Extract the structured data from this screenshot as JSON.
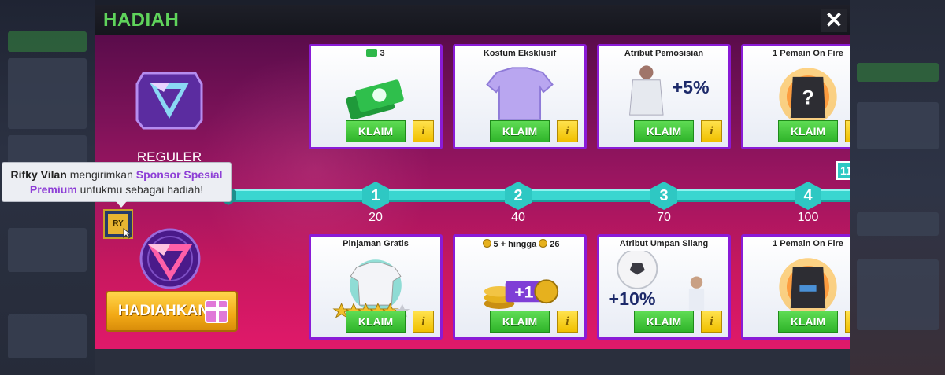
{
  "modal": {
    "title": "HADIAH",
    "close_glyph": "✕"
  },
  "tiers": {
    "regular_label": "REGULER",
    "gift_button_label": "HADIAHKAN"
  },
  "tooltip": {
    "sender": "Rifky Vilan",
    "text_before": " mengirimkan ",
    "highlight": "Sponsor Spesial Premium",
    "text_after": " untukmu sebagai hadiah!"
  },
  "avatar_initials": "RY",
  "edge_badge": "11",
  "milestones": [
    {
      "number": "1",
      "value": "20"
    },
    {
      "number": "2",
      "value": "40"
    },
    {
      "number": "3",
      "value": "70"
    },
    {
      "number": "4",
      "value": "100"
    }
  ],
  "regular_rewards": [
    {
      "title": "3",
      "title_icon": "cash-icon",
      "art": "cash-stack",
      "claim": "KLAIM",
      "info": "i"
    },
    {
      "title": "Kostum Eksklusif",
      "art": "jersey",
      "claim": "KLAIM",
      "info": "i"
    },
    {
      "title": "Atribut Pemosisian",
      "art": "player-plus-5",
      "overlay": "+5%",
      "claim": "KLAIM",
      "info": "i"
    },
    {
      "title": "1 Pemain On Fire",
      "art": "mystery-jersey-fire",
      "claim": "KLAIM",
      "info": "i"
    }
  ],
  "premium_rewards": [
    {
      "title": "Pinjaman Gratis",
      "art": "loan-jersey-stars",
      "claim": "KLAIM",
      "info": "i"
    },
    {
      "title_a": "5 + hingga",
      "title_b": "26",
      "art": "coin-stack",
      "overlay": "+1",
      "claim": "KLAIM",
      "info": "i"
    },
    {
      "title": "Atribut Umpan Silang",
      "art": "ball-plus-10",
      "overlay": "+10%",
      "claim": "KLAIM",
      "info": "i"
    },
    {
      "title": "1 Pemain On Fire",
      "art": "jersey-fire",
      "claim": "KLAIM",
      "info": "i"
    }
  ],
  "colors": {
    "title_green": "#5fd35b",
    "track": "#3ad6d0",
    "card_border": "#8a1bd6",
    "claim_green": "#3cc335",
    "gift_gold": "#f2a916"
  }
}
